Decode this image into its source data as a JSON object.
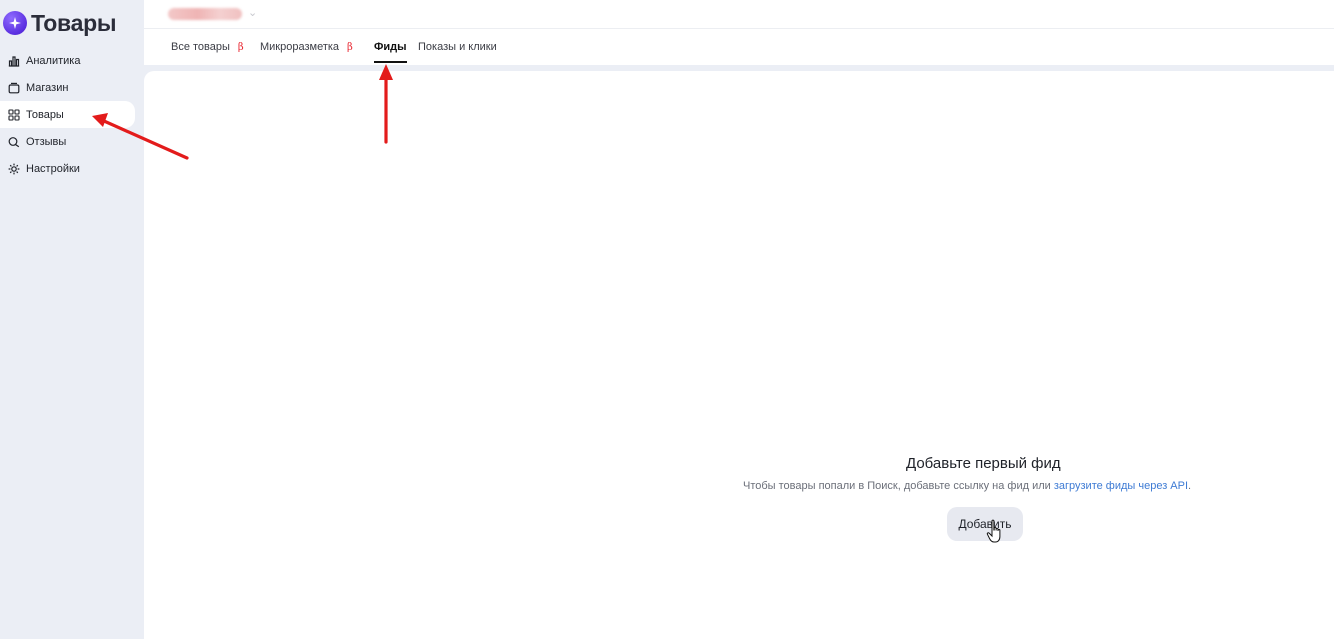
{
  "app": {
    "title": "Товары"
  },
  "sidebar": {
    "items": [
      {
        "label": "Аналитика",
        "icon": "bar-chart-icon"
      },
      {
        "label": "Магазин",
        "icon": "store-icon"
      },
      {
        "label": "Товары",
        "icon": "grid-icon",
        "active": true
      },
      {
        "label": "Отзывы",
        "icon": "reviews-icon"
      },
      {
        "label": "Настройки",
        "icon": "gear-icon"
      }
    ]
  },
  "header": {
    "project_chevron": "⌄"
  },
  "tabs": [
    {
      "label": "Все товары",
      "badge": "β"
    },
    {
      "label": "Микроразметка",
      "badge": "β"
    },
    {
      "label": "Фиды",
      "active": true
    },
    {
      "label": "Показы и клики"
    }
  ],
  "empty_state": {
    "title": "Добавьте первый фид",
    "text": "Чтобы товары попали в Поиск, добавьте ссылку на фид или ",
    "link": "загрузите фиды через API",
    "text_end": ".",
    "button": "Добавить"
  },
  "colors": {
    "accent": "#5a2fe0",
    "beta": "#e8242e",
    "link": "#3e7bd4",
    "annotation": "#e31b1b"
  }
}
